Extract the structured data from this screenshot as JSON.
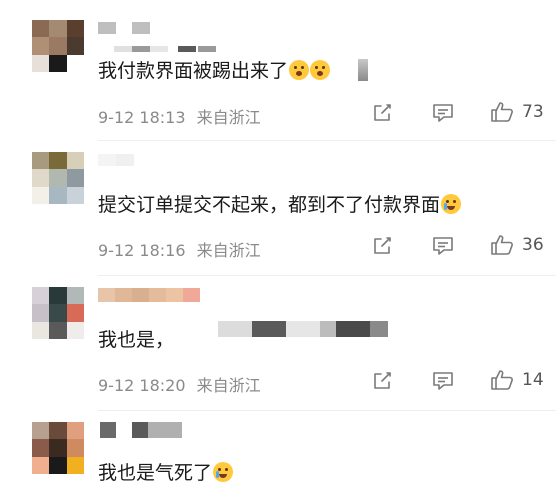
{
  "comments": [
    {
      "text": "我付款界面被踢出来了",
      "time": "9-12 18:13",
      "location": "来自浙江",
      "likes": "73",
      "avatar": [
        "#8a6a52",
        "#a58a72",
        "#5a3f2f",
        "#b08f77",
        "#9a7a62",
        "#4a3a30",
        "#e8e0d8",
        "#1a1a1a",
        "#ffffff"
      ],
      "emoji": [
        "scream-emoji",
        "scream-emoji"
      ]
    },
    {
      "text": "提交订单提交不起来，都到不了付款界面",
      "time": "9-12 18:16",
      "location": "来自浙江",
      "likes": "36",
      "avatar": [
        "#a89a7e",
        "#7a6a3a",
        "#d8cfb8",
        "#e0d8c8",
        "#b0b8b0",
        "#8f9aa0",
        "#f2f0e8",
        "#a8b8c2",
        "#c8d2d8"
      ],
      "emoji": [
        "crying-emoji"
      ]
    },
    {
      "text": "我也是，",
      "time": "9-12 18:20",
      "location": "来自浙江",
      "likes": "14",
      "avatar": [
        "#d8d0d8",
        "#2a3a3a",
        "#b0b8b8",
        "#c8c0c8",
        "#3a4a4a",
        "#d86a58",
        "#e8e8e0",
        "#5a5a5a",
        "#f0ecec"
      ],
      "emoji": []
    },
    {
      "text": "我也是气死了",
      "time": "",
      "location": "",
      "likes": "",
      "avatar": [
        "#b8a090",
        "#6a4a3a",
        "#e0a080",
        "#8a5a4a",
        "#3a2a20",
        "#d08a60",
        "#f0b090",
        "#1a1a1a",
        "#f0b020"
      ],
      "emoji": [
        "crying-emoji"
      ]
    }
  ]
}
